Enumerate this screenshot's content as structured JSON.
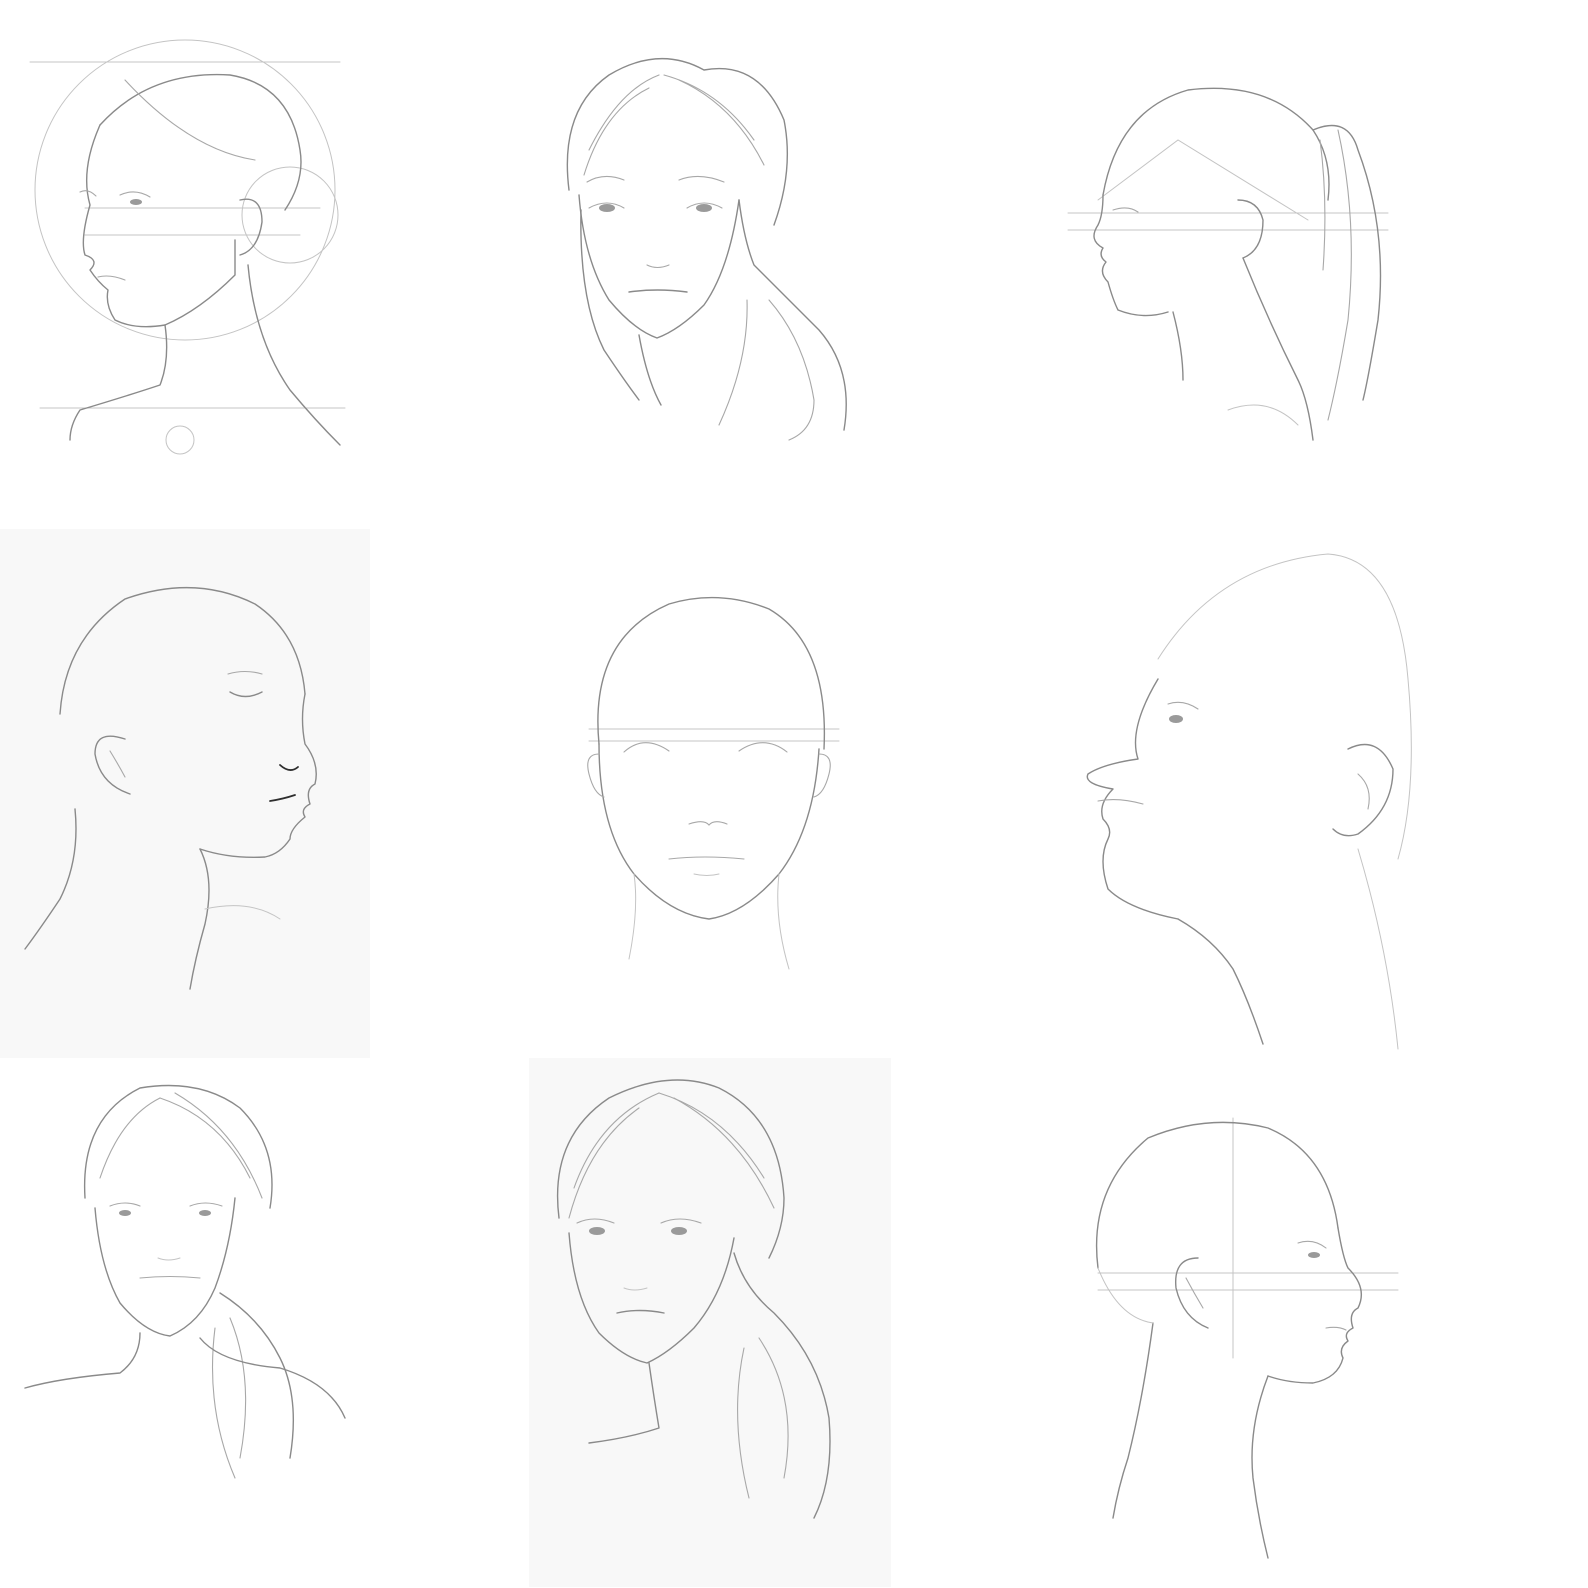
{
  "gallery": {
    "background": "#ffffff",
    "line_color": "#8a8a8a",
    "paper_tint": "#f8f8f8",
    "sketches": [
      {
        "view": "three-quarter-left",
        "guides": true,
        "hair": "bun"
      },
      {
        "view": "front",
        "guides": false,
        "hair": "low-ponytail"
      },
      {
        "view": "profile-left",
        "guides": true,
        "hair": "ponytail"
      },
      {
        "view": "three-quarter-right",
        "guides": false,
        "hair": "bald",
        "eyes": "closed",
        "paper": true
      },
      {
        "view": "front",
        "guides": true,
        "hair": "bald"
      },
      {
        "view": "profile-left",
        "guides": false,
        "hair": "bald"
      },
      {
        "view": "front",
        "guides": false,
        "hair": "low-ponytail"
      },
      {
        "view": "front",
        "guides": false,
        "hair": "low-ponytail",
        "paper": true
      },
      {
        "view": "profile-right",
        "guides": true,
        "hair": "bald"
      }
    ]
  }
}
